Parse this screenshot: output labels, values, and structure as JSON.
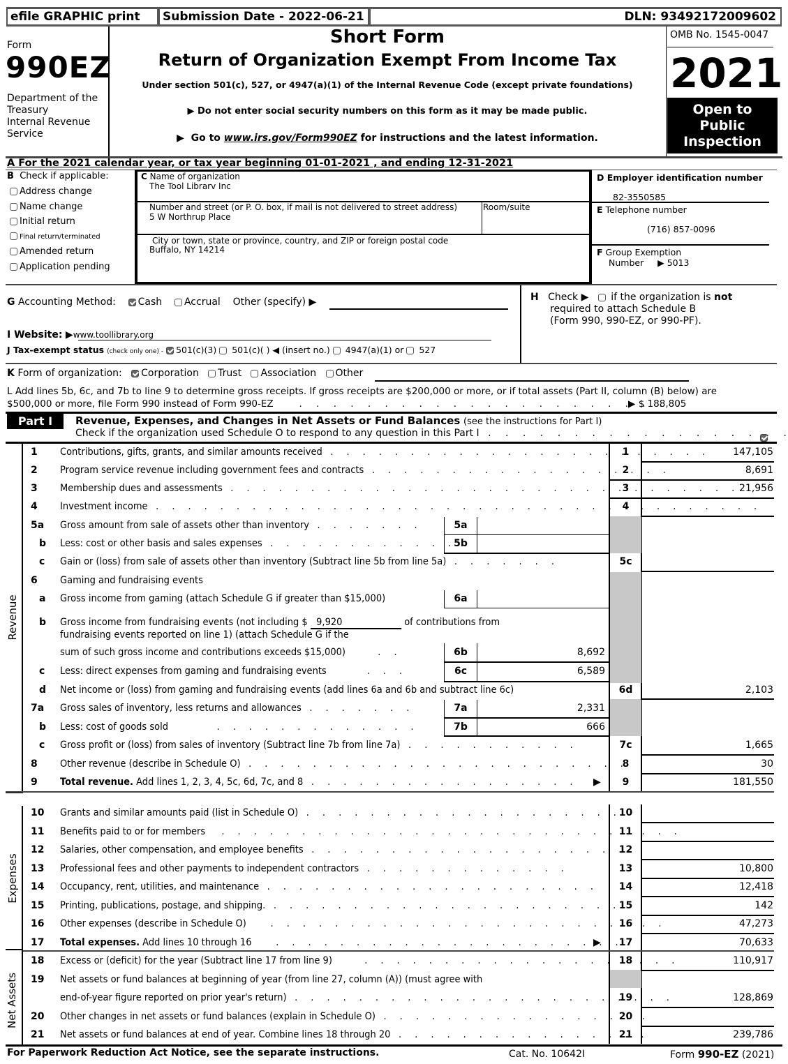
{
  "topbar": {
    "efile": "efile GRAPHIC print",
    "submission": "Submission Date - 2022-06-21",
    "dln": "DLN: 93492172009602"
  },
  "header": {
    "form_word": "Form",
    "form_number": "990EZ",
    "dept": [
      "Department of the",
      "Treasury",
      "Internal Revenue",
      "Service"
    ],
    "title1": "Short Form",
    "title2": "Return of Organization Exempt From Income Tax",
    "subtitle": "Under section 501(c), 527, or 4947(a)(1) of the Internal Revenue Code (except private foundations)",
    "notice1": "Do not enter social security numbers on this form as it may be made public.",
    "notice2_pre": "Go to ",
    "notice2_link": "www.irs.gov/Form990EZ",
    "notice2_post": " for instructions and the latest information.",
    "omb": "OMB No. 1545-0047",
    "year": "2021",
    "open": [
      "Open to",
      "Public",
      "Inspection"
    ]
  },
  "lineA": "A  For the 2021 calendar year, or tax year beginning 01-01-2021  , and ending 12-31-2021",
  "sectionB": {
    "label": "B",
    "title": "Check if applicable:",
    "items": [
      {
        "label": "Address change",
        "checked": false
      },
      {
        "label": "Name change",
        "checked": false
      },
      {
        "label": "Initial return",
        "checked": false
      },
      {
        "label": "Final return/terminated",
        "checked": false
      },
      {
        "label": "Amended return",
        "checked": false
      },
      {
        "label": "Application pending",
        "checked": false
      }
    ]
  },
  "sectionC": {
    "name_label": "Name of organization",
    "name_value": "The Tool Librarv Inc",
    "street_label": "Number and street (or P. O. box, if mail is not delivered to street address)",
    "street_value": "5 W Northrup Place",
    "room_label": "Room/suite",
    "city_label": "City or town, state or province, country, and ZIP or foreign postal code",
    "city_value": "Buffalo, NY   14214"
  },
  "sectionD": {
    "label": "D Employer identification number",
    "value": "82-3550585"
  },
  "sectionE": {
    "label": "Telephone number",
    "value": "(716) 857-0096"
  },
  "sectionF": {
    "label1": "Group Exemption",
    "label2": "Number",
    "value": "5013"
  },
  "sectionG": {
    "label": "Accounting Method:",
    "cash": "Cash",
    "accrual": "Accrual",
    "other": "Other (specify)"
  },
  "sectionH": {
    "pre": "Check",
    "mid": "if the organization is",
    "not": "not",
    "line2": "required to attach Schedule B",
    "line3": "(Form 990, 990-EZ, or 990-PF)."
  },
  "sectionI": {
    "label": "I Website:",
    "value": "www.toollibrary.org"
  },
  "sectionJ": {
    "label": "J Tax-exempt status",
    "small": "(check only one) -",
    "opt1": "501(c)(3)",
    "opt2": "501(c)(   )",
    "insert": "(insert no.)",
    "opt3": "4947(a)(1) or",
    "opt4": "527"
  },
  "sectionK": {
    "label": "Form of organization:",
    "opt1": "Corporation",
    "opt2": "Trust",
    "opt3": "Association",
    "opt4": "Other"
  },
  "sectionL": {
    "line1": "L Add lines 5b, 6c, and 7b to line 9 to determine gross receipts. If gross receipts are $200,000 or more, or if total assets (Part II, column (B) below) are",
    "line2": "$500,000 or more, file Form 990 instead of Form 990-EZ",
    "value": "$ 188,805"
  },
  "part1": {
    "tag": "Part I",
    "title": "Revenue, Expenses, and Changes in Net Assets or Fund Balances",
    "title_note": "(see the instructions for Part I)",
    "check_line": "Check if the organization used Schedule O to respond to any question in this Part I",
    "side_revenue": "Revenue",
    "side_expenses": "Expenses",
    "side_net": "Net Assets",
    "lines": {
      "l1": {
        "num": "1",
        "desc": "Contributions, gifts, grants, and similar amounts received",
        "box": "1",
        "value": "147,105"
      },
      "l2": {
        "num": "2",
        "desc": "Program service revenue including government fees and contracts",
        "box": "2",
        "value": "8,691"
      },
      "l3": {
        "num": "3",
        "desc": "Membership dues and assessments",
        "box": "3",
        "value": "21,956"
      },
      "l4": {
        "num": "4",
        "desc": "Investment income",
        "box": "4",
        "value": ""
      },
      "l5a": {
        "num": "5a",
        "desc": "Gross amount from sale of assets other than inventory",
        "box": "5a",
        "value": ""
      },
      "l5b": {
        "num": "b",
        "desc": "Less: cost or other basis and sales expenses",
        "box": "5b",
        "value": ""
      },
      "l5c": {
        "num": "c",
        "desc": "Gain or (loss) from sale of assets other than inventory (Subtract line 5b from line 5a)",
        "box": "5c",
        "value": ""
      },
      "l6": {
        "num": "6",
        "desc": "Gaming and fundraising events"
      },
      "l6a": {
        "num": "a",
        "desc": "Gross income from gaming (attach Schedule G if greater than $15,000)",
        "box": "6a",
        "value": ""
      },
      "l6b": {
        "num": "b",
        "desc1": "Gross income from fundraising events (not including $",
        "excluded": "9,920",
        "desc1b": "of contributions from",
        "desc2": "fundraising events reported on line 1) (attach Schedule G if the",
        "desc3": "sum of such gross income and contributions exceeds $15,000)",
        "box": "6b",
        "value": "8,692"
      },
      "l6c": {
        "num": "c",
        "desc": "Less: direct expenses from gaming and fundraising events",
        "box": "6c",
        "value": "6,589"
      },
      "l6d": {
        "num": "d",
        "desc": "Net income or (loss) from gaming and fundraising events (add lines 6a and 6b and subtract line 6c)",
        "box": "6d",
        "value": "2,103"
      },
      "l7a": {
        "num": "7a",
        "desc": "Gross sales of inventory, less returns and allowances",
        "box": "7a",
        "value": "2,331"
      },
      "l7b": {
        "num": "b",
        "desc": "Less: cost of goods sold",
        "box": "7b",
        "value": "666"
      },
      "l7c": {
        "num": "c",
        "desc": "Gross profit or (loss) from sales of inventory (Subtract line 7b from line 7a)",
        "box": "7c",
        "value": "1,665"
      },
      "l8": {
        "num": "8",
        "desc": "Other revenue (describe in Schedule O)",
        "box": "8",
        "value": "30"
      },
      "l9": {
        "num": "9",
        "desc_bold": "Total revenue.",
        "desc": " Add lines 1, 2, 3, 4, 5c, 6d, 7c, and 8",
        "box": "9",
        "value": "181,550"
      },
      "l10": {
        "num": "10",
        "desc": "Grants and similar amounts paid (list in Schedule O)",
        "box": "10",
        "value": ""
      },
      "l11": {
        "num": "11",
        "desc": "Benefits paid to or for members",
        "box": "11",
        "value": ""
      },
      "l12": {
        "num": "12",
        "desc": "Salaries, other compensation, and employee benefits",
        "box": "12",
        "value": ""
      },
      "l13": {
        "num": "13",
        "desc": "Professional fees and other payments to independent contractors",
        "box": "13",
        "value": "10,800"
      },
      "l14": {
        "num": "14",
        "desc": "Occupancy, rent, utilities, and maintenance",
        "box": "14",
        "value": "12,418"
      },
      "l15": {
        "num": "15",
        "desc": "Printing, publications, postage, and shipping.",
        "box": "15",
        "value": "142"
      },
      "l16": {
        "num": "16",
        "desc": "Other expenses (describe in Schedule O)",
        "box": "16",
        "value": "47,273"
      },
      "l17": {
        "num": "17",
        "desc_bold": "Total expenses.",
        "desc": " Add lines 10 through 16",
        "box": "17",
        "value": "70,633"
      },
      "l18": {
        "num": "18",
        "desc": "Excess or (deficit) for the year (Subtract line 17 from line 9)",
        "box": "18",
        "value": "110,917"
      },
      "l19": {
        "num": "19",
        "desc1": "Net assets or fund balances at beginning of year (from line 27, column (A)) (must agree with",
        "desc2": "end-of-year figure reported on prior year's return)",
        "box": "19",
        "value": "128,869"
      },
      "l20": {
        "num": "20",
        "desc": "Other changes in net assets or fund balances (explain in Schedule O)",
        "box": "20",
        "value": ""
      },
      "l21": {
        "num": "21",
        "desc": "Net assets or fund balances at end of year. Combine lines 18 through 20",
        "box": "21",
        "value": "239,786"
      }
    }
  },
  "footer": {
    "left": "For Paperwork Reduction Act Notice, see the separate instructions.",
    "cat": "Cat. No. 10642I",
    "form_pre": "Form ",
    "form_bold": "990-EZ",
    "form_post": " (2021)"
  }
}
